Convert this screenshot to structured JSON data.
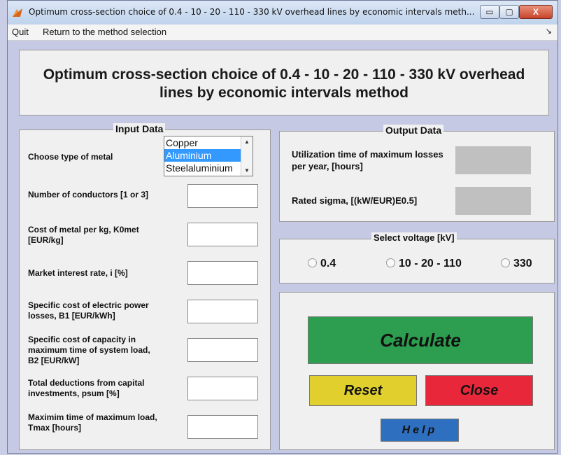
{
  "window": {
    "title": "Optimum cross-section choice of 0.4 - 10 - 20 - 110 - 330 kV overhead lines by economic intervals meth...",
    "controls": {
      "minimize": "▭",
      "maximize": "▢",
      "close": "X"
    }
  },
  "menu": {
    "quit": "Quit",
    "return": "Return to the method selection",
    "overflow": "↘"
  },
  "header": {
    "title": "Optimum cross-section choice of  0.4 - 10 - 20 - 110 - 330 kV overhead lines by economic intervals method"
  },
  "input": {
    "title": "Input Data",
    "metal_label": "Choose type of metal",
    "metal_options": [
      "Copper",
      "Aluminium",
      "Steelaluminium"
    ],
    "metal_selected": "Aluminium",
    "fields": [
      {
        "label": "Number of conductors [1 or 3]",
        "value": ""
      },
      {
        "label": "Cost of metal per kg, K0met [EUR/kg]",
        "value": ""
      },
      {
        "label": "Market interest rate, i [%]",
        "value": ""
      },
      {
        "label": "Specific cost of electric power losses, B1 [EUR/kWh]",
        "value": ""
      },
      {
        "label": "Specific cost of  capacity in maximum time of system load, B2 [EUR/kW]",
        "value": ""
      },
      {
        "label": "Total deductions from capital investments, psum [%]",
        "value": ""
      },
      {
        "label": "Maximim time of maximum load, Tmax [hours]",
        "value": ""
      }
    ]
  },
  "output": {
    "title": "Output Data",
    "utilization_label": "Utilization time of maximum losses per year, [hours]",
    "utilization_value": "",
    "sigma_label": "Rated sigma, [(kW/EUR)E0.5]",
    "sigma_value": ""
  },
  "voltage": {
    "title": "Select voltage [kV]",
    "options": [
      "0.4",
      "10 - 20 - 110",
      "330"
    ],
    "selected": ""
  },
  "buttons": {
    "calculate": "Calculate",
    "reset": "Reset",
    "close": "Close",
    "help": "Help"
  },
  "colors": {
    "calculate": "#2d9e4f",
    "reset": "#e0cf2c",
    "close": "#e8283a",
    "help": "#2f6fbf",
    "selection": "#3399ff"
  }
}
